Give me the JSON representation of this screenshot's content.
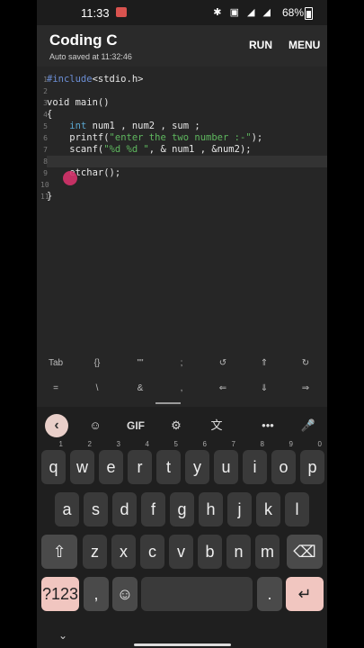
{
  "status": {
    "time": "11:33",
    "icons": "✱ ▣ ◢ ◢",
    "battery": "68%"
  },
  "app": {
    "title": "Coding C",
    "subtitle": "Auto saved at 11:32:46",
    "run": "RUN",
    "menu": "MENU"
  },
  "editor": {
    "lines": [
      {
        "n": "1",
        "html": "<span class=\"inc\">#include</span>&lt;stdio.h&gt;"
      },
      {
        "n": "2",
        "html": ""
      },
      {
        "n": "3",
        "html": "void main()"
      },
      {
        "n": "4",
        "html": "{"
      },
      {
        "n": "5",
        "html": "    <span class=\"kw\">int</span> num1 , num2 , sum ;"
      },
      {
        "n": "6",
        "html": "    printf(<span class=\"str\">\"enter the two number :-\"</span>);"
      },
      {
        "n": "7",
        "html": "    scanf(<span class=\"str\">\"%d %d \"</span>, &amp; num1 , &amp;num2);"
      },
      {
        "n": "8",
        "html": ""
      },
      {
        "n": "9",
        "html": "    etchar();"
      },
      {
        "n": "10",
        "html": ""
      },
      {
        "n": "11",
        "html": "}"
      }
    ]
  },
  "extra_keys": {
    "row1": [
      "Tab",
      "{}",
      "\"\"",
      ";",
      "↺",
      "⇑",
      "↻"
    ],
    "row2": [
      "=",
      "\\",
      "&",
      ",",
      "⇐",
      "⇓",
      "⇒"
    ]
  },
  "keyboard": {
    "toolbar": [
      "‹",
      "☺",
      "GIF",
      "⚙",
      "文",
      "•••",
      "🎤"
    ],
    "row1": [
      [
        "q",
        "1"
      ],
      [
        "w",
        "2"
      ],
      [
        "e",
        "3"
      ],
      [
        "r",
        "4"
      ],
      [
        "t",
        "5"
      ],
      [
        "y",
        "6"
      ],
      [
        "u",
        "7"
      ],
      [
        "i",
        "8"
      ],
      [
        "o",
        "9"
      ],
      [
        "p",
        "0"
      ]
    ],
    "row2": [
      "a",
      "s",
      "d",
      "f",
      "g",
      "h",
      "j",
      "k",
      "l"
    ],
    "row3": [
      "⇧",
      "z",
      "x",
      "c",
      "v",
      "b",
      "n",
      "m",
      "⌫"
    ],
    "row4": {
      "sym": "?123",
      "comma": ",",
      "emoji": "☺",
      "space": "",
      "period": ".",
      "enter": "↵"
    }
  },
  "nav": {
    "chevron": "⌄"
  }
}
